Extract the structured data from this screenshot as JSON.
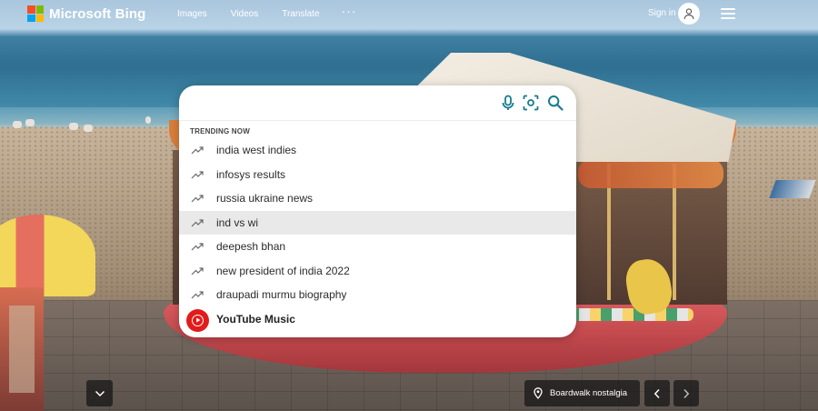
{
  "header": {
    "logo_text": "Microsoft Bing",
    "nav": [
      "Images",
      "Videos",
      "Translate"
    ],
    "more_label": "···",
    "signin_label": "Sign in"
  },
  "brand_colors": [
    "#f25022",
    "#7fba00",
    "#00a4ef",
    "#ffb900"
  ],
  "search": {
    "value": "",
    "placeholder": "",
    "icons": [
      "mic-icon",
      "visual-search-icon",
      "search-icon"
    ],
    "accent_color": "#167c8f"
  },
  "suggestions": {
    "header": "TRENDING NOW",
    "items": [
      "india west indies",
      "infosys results",
      "russia ukraine news",
      "ind vs wi",
      "deepesh bhan",
      "new president of india 2022",
      "draupadi murmu biography"
    ],
    "highlighted_index": 3,
    "app_suggestion": "YouTube Music"
  },
  "footer": {
    "caption": "Boardwalk nostalgia",
    "icons": [
      "chevron-down-icon",
      "location-pin-icon",
      "chevron-left-icon",
      "chevron-right-icon"
    ]
  }
}
